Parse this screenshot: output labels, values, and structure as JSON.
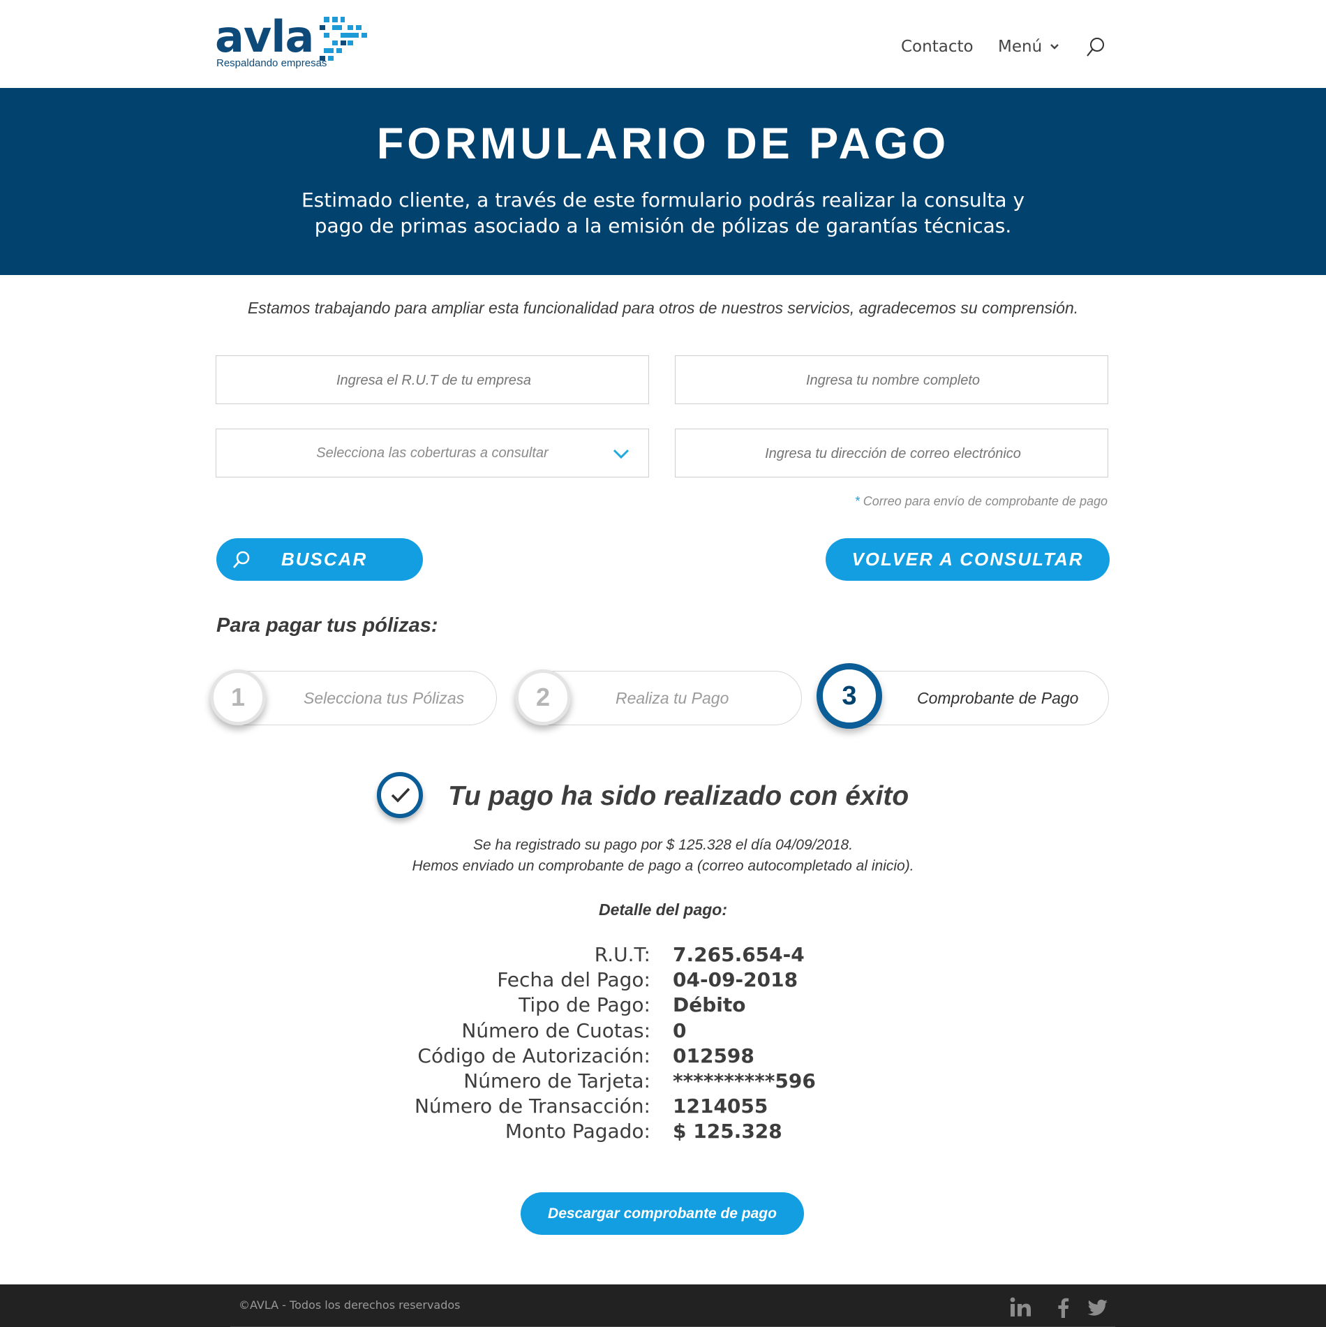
{
  "header": {
    "logo_word": "avla",
    "logo_tagline": "Respaldando empresas",
    "nav": {
      "contacto": "Contacto",
      "menu": "Menú"
    },
    "icons": {
      "search": "search-icon",
      "menu_chevron": "chevron-down-icon"
    }
  },
  "banner": {
    "title": "FORMULARIO DE PAGO",
    "text": "Estimado cliente, a través de este formulario podrás realizar la consulta y pago de primas asociado a la emisión de pólizas de garantías técnicas."
  },
  "notice": "Estamos trabajando para ampliar esta funcionalidad para otros de nuestros servicios, agradecemos su comprensión.",
  "form": {
    "rut_placeholder": "Ingresa el R.U.T de tu empresa",
    "name_placeholder": "Ingresa tu nombre completo",
    "coverage_select": "Selecciona las coberturas a consultar",
    "email_placeholder": "Ingresa tu dirección de correo electrónico",
    "email_note_star": "*",
    "email_note": "Correo para envío de comprobante de pago"
  },
  "buttons": {
    "buscar": "BUSCAR",
    "volver": "VOLVER A CONSULTAR",
    "download": "Descargar comprobante de pago"
  },
  "steps": {
    "title": "Para pagar tus pólizas:",
    "items": [
      {
        "number": "1",
        "label": "Selecciona tus Pólizas",
        "active": false
      },
      {
        "number": "2",
        "label": "Realiza tu Pago",
        "active": false
      },
      {
        "number": "3",
        "label": "Comprobante de Pago",
        "active": true
      }
    ]
  },
  "success": {
    "title": "Tu pago ha sido realizado con éxito",
    "line1": "Se ha registrado su pago por $ 125.328 el día 04/09/2018.",
    "line2": "Hemos enviado un comprobante de pago a (correo autocompletado al inicio).",
    "detail_title": "Detalle del pago:"
  },
  "details": [
    {
      "label": "R.U.T:",
      "value": "7.265.654-4"
    },
    {
      "label": "Fecha del Pago:",
      "value": "04-09-2018"
    },
    {
      "label": "Tipo de Pago:",
      "value": "Débito"
    },
    {
      "label": "Número de Cuotas:",
      "value": "0"
    },
    {
      "label": "Código de Autorización:",
      "value": "012598"
    },
    {
      "label": "Número de Tarjeta:",
      "value": "**********596"
    },
    {
      "label": "Número de Transacción:",
      "value": "1214055"
    },
    {
      "label": "Monto Pagado:",
      "value": "$ 125.328"
    }
  ],
  "footer": {
    "copyright": "©AVLA - Todos los derechos reservados",
    "social": [
      "linkedin-icon",
      "facebook-icon",
      "twitter-icon"
    ]
  },
  "colors": {
    "brand_dark": "#01426f",
    "accent": "#129ee0",
    "step_active": "#0b5d97",
    "footer_bg": "#222222"
  }
}
